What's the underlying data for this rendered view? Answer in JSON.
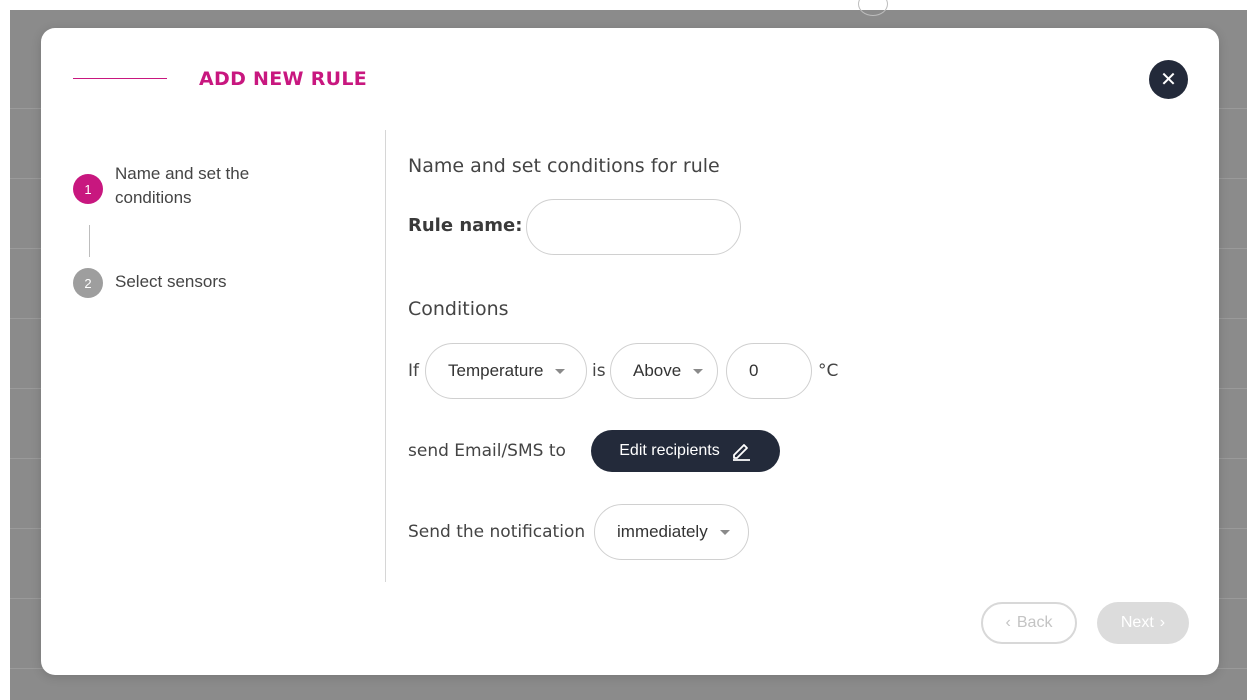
{
  "modal": {
    "title": "ADD NEW RULE",
    "close_icon": "close-icon",
    "accent_color": "#c8177f",
    "dark_color": "#232a3a"
  },
  "steps": [
    {
      "number": "1",
      "label": "Name and set the conditions",
      "state": "active"
    },
    {
      "number": "2",
      "label": "Select sensors",
      "state": "inactive"
    }
  ],
  "form": {
    "heading": "Name and set conditions for rule",
    "rule_name_label": "Rule name:",
    "rule_name_value": "",
    "conditions_heading": "Conditions",
    "if_text": "If",
    "metric_selected": "Temperature",
    "is_text": "is",
    "comparator_selected": "Above",
    "threshold_value": "0",
    "unit": "°C",
    "send_text": "send Email/SMS to",
    "edit_recipients_label": "Edit recipients",
    "edit_icon": "pencil-icon",
    "notification_text": "Send the notification",
    "timing_selected": "immediately"
  },
  "footer": {
    "back_label": "Back",
    "next_label": "Next"
  }
}
